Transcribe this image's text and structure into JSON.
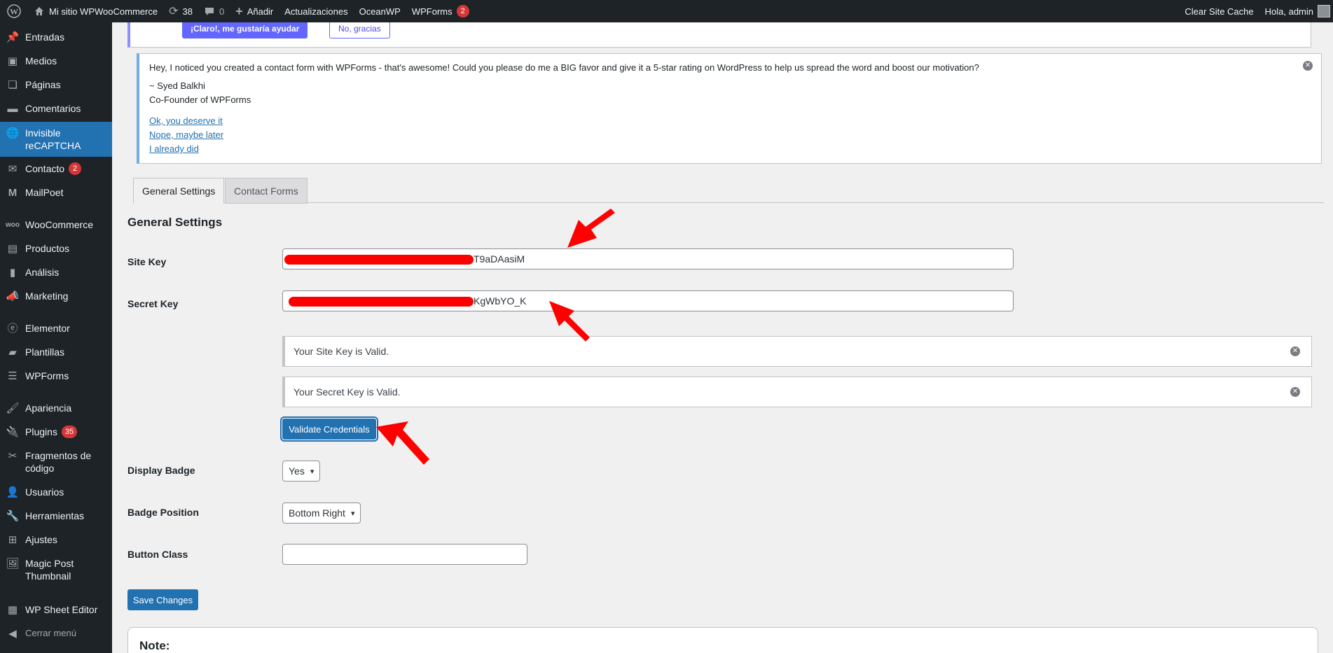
{
  "adminbar": {
    "site_name": "Mi sitio WPWooCommerce",
    "updates_count": "38",
    "comments_count": "0",
    "add_new": "Añadir",
    "updates": "Actualizaciones",
    "oceanwp": "OceanWP",
    "wpforms": "WPForms",
    "wpforms_count": "2",
    "clear_cache": "Clear Site Cache",
    "greeting": "Hola, admin"
  },
  "sidebar": {
    "items": [
      {
        "label": "Entradas",
        "icon": "pin-icon"
      },
      {
        "label": "Medios",
        "icon": "media-icon"
      },
      {
        "label": "Páginas",
        "icon": "pages-icon"
      },
      {
        "label": "Comentarios",
        "icon": "comments-icon"
      },
      {
        "label": "Invisible reCAPTCHA",
        "icon": "globe-icon"
      },
      {
        "label": "Contacto",
        "icon": "mail-icon",
        "badge": "2"
      },
      {
        "label": "MailPoet",
        "icon": "mailpoet-icon"
      },
      {
        "label": "WooCommerce",
        "icon": "woo-icon"
      },
      {
        "label": "Productos",
        "icon": "archive-icon"
      },
      {
        "label": "Análisis",
        "icon": "chart-icon"
      },
      {
        "label": "Marketing",
        "icon": "megaphone-icon"
      },
      {
        "label": "Elementor",
        "icon": "elementor-icon"
      },
      {
        "label": "Plantillas",
        "icon": "folder-icon"
      },
      {
        "label": "WPForms",
        "icon": "forms-icon"
      },
      {
        "label": "Apariencia",
        "icon": "brush-icon"
      },
      {
        "label": "Plugins",
        "icon": "plugin-icon",
        "badge": "35"
      },
      {
        "label": "Fragmentos de código",
        "icon": "scissors-icon"
      },
      {
        "label": "Usuarios",
        "icon": "user-icon"
      },
      {
        "label": "Herramientas",
        "icon": "wrench-icon"
      },
      {
        "label": "Ajustes",
        "icon": "settings-icon"
      },
      {
        "label": "Magic Post Thumbnail",
        "icon": "image-icon"
      },
      {
        "label": "WP Sheet Editor",
        "icon": "sheet-icon"
      },
      {
        "label": "Cerrar menú",
        "icon": "collapse-icon"
      }
    ]
  },
  "top_notice": {
    "primary_button": "¡Claro!, me gustaría ayudar",
    "secondary_button": "No, gracias"
  },
  "wpforms_notice": {
    "message": "Hey, I noticed you created a contact form with WPForms - that's awesome! Could you please do me a BIG favor and give it a 5-star rating on WordPress to help us spread the word and boost our motivation?",
    "signature_name": "~ Syed Balkhi",
    "signature_title": "Co-Founder of WPForms",
    "link_yes": "Ok, you deserve it",
    "link_later": "Nope, maybe later",
    "link_done": "I already did"
  },
  "tabs": [
    "General Settings",
    "Contact Forms"
  ],
  "settings": {
    "title": "General Settings",
    "site_key_label": "Site Key",
    "site_key_visible_suffix": "T9aDAasiM",
    "secret_key_label": "Secret Key",
    "secret_key_visible_suffix": "KgWbYO_K",
    "site_key_valid": "Your Site Key is Valid.",
    "secret_key_valid": "Your Secret Key is Valid.",
    "validate_button": "Validate Credentials",
    "display_badge_label": "Display Badge",
    "display_badge_value": "Yes",
    "badge_position_label": "Badge Position",
    "badge_position_value": "Bottom Right",
    "button_class_label": "Button Class",
    "button_class_value": "",
    "save_button": "Save Changes",
    "note_title": "Note:"
  },
  "colors": {
    "wp_dark": "#1d2327",
    "wp_blue": "#2271b1",
    "badge_red": "#d63638",
    "annotation_red": "#ff0000"
  }
}
